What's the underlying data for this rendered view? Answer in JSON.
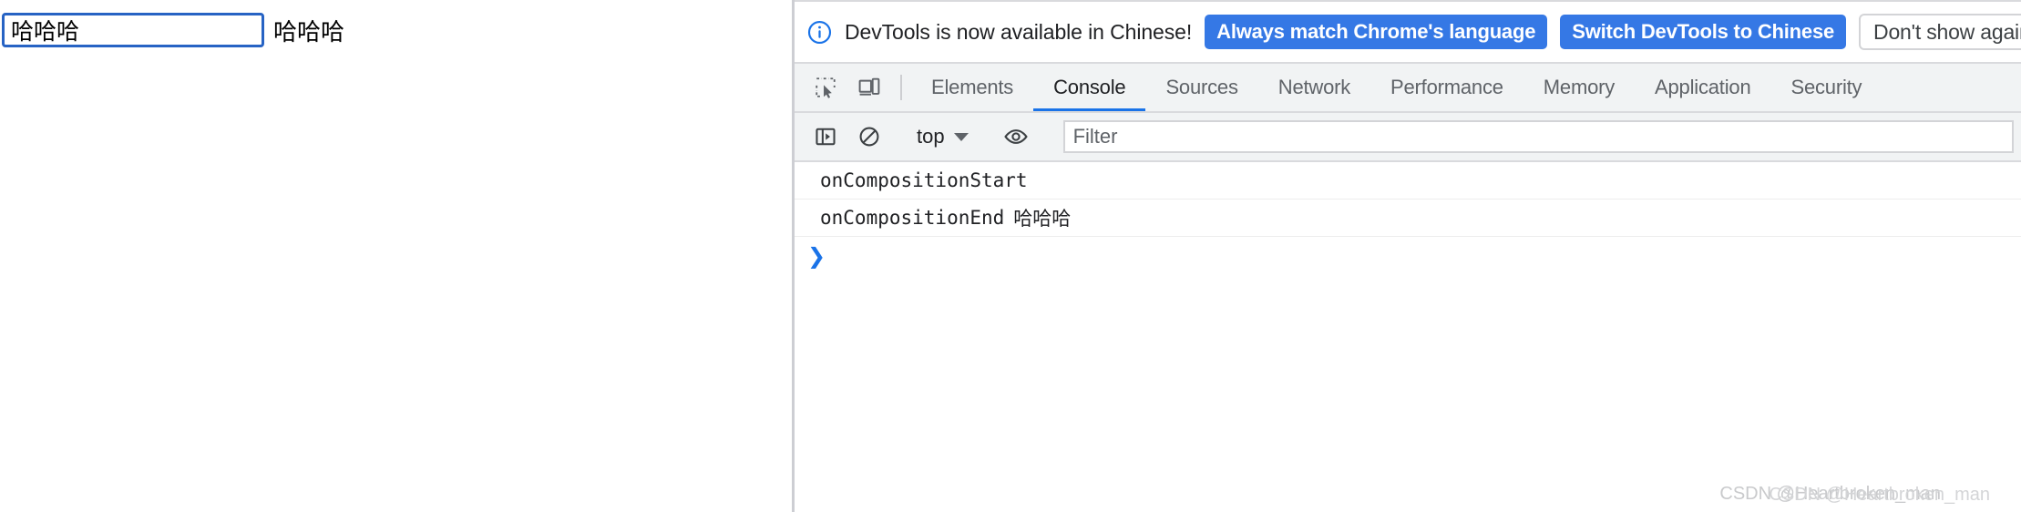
{
  "page": {
    "input_value": "哈哈哈",
    "input_placeholder": "",
    "mirror_text": "哈哈哈"
  },
  "devtools": {
    "notification": {
      "icon": "info-circle-icon",
      "message": "DevTools is now available in Chinese!",
      "primary_button": "Always match Chrome's language",
      "secondary_button": "Switch DevTools to Chinese",
      "dismiss_button": "Don't show again"
    },
    "toolbar_icons": {
      "inspect": "inspect-element-icon",
      "device": "device-toolbar-icon"
    },
    "tabs": [
      {
        "label": "Elements",
        "active": false
      },
      {
        "label": "Console",
        "active": true
      },
      {
        "label": "Sources",
        "active": false
      },
      {
        "label": "Network",
        "active": false
      },
      {
        "label": "Performance",
        "active": false
      },
      {
        "label": "Memory",
        "active": false
      },
      {
        "label": "Application",
        "active": false
      },
      {
        "label": "Security",
        "active": false
      }
    ],
    "console_toolbar": {
      "sidebar_icon": "console-sidebar-icon",
      "clear_icon": "clear-console-icon",
      "context": "top",
      "eye_icon": "live-expression-eye-icon",
      "filter_placeholder": "Filter",
      "filter_value": ""
    },
    "console_messages": [
      {
        "text": "onCompositionStart",
        "cjk": ""
      },
      {
        "text": "onCompositionEnd",
        "cjk": "哈哈哈"
      }
    ],
    "prompt_glyph": "❯"
  },
  "watermark": {
    "text": "CSDN @Heartbroken_man",
    "duplicate": "CSDN @Heartbroken_man"
  },
  "colors": {
    "accent_blue": "#1a73e8",
    "button_blue": "#3578e5",
    "input_focus_border": "#2763c4",
    "toolbar_bg": "#f1f3f4",
    "border": "#d9dadd"
  }
}
